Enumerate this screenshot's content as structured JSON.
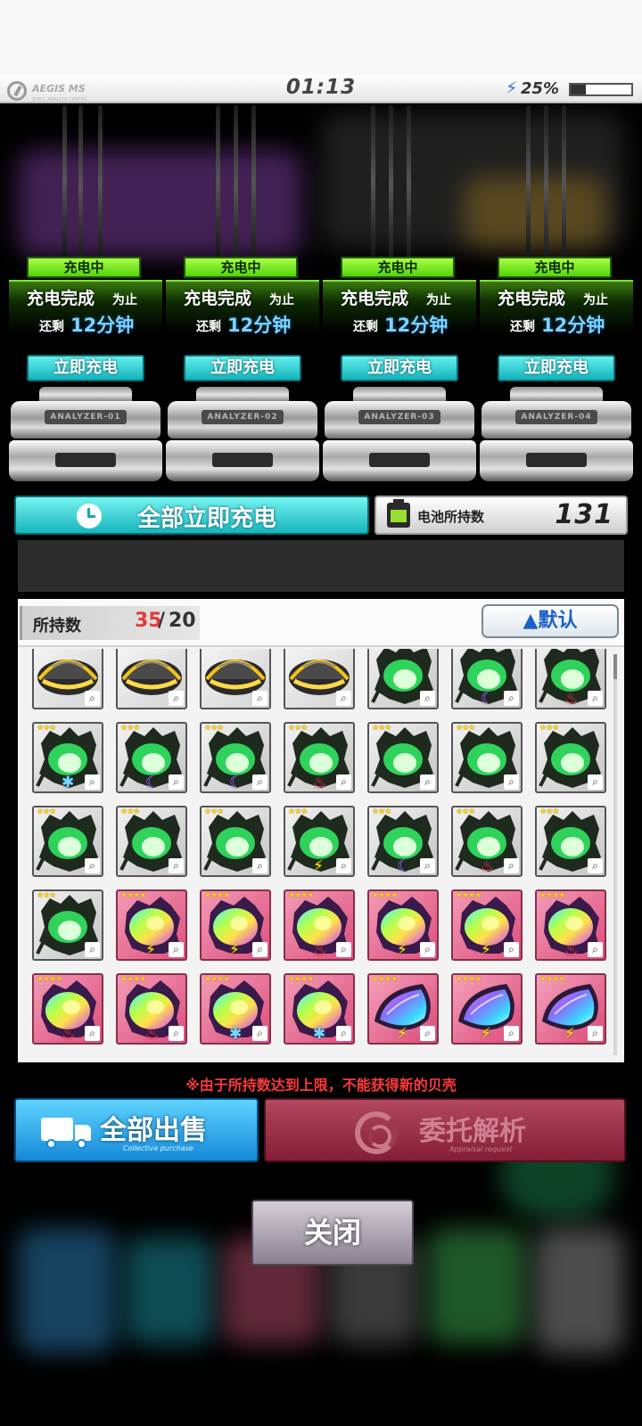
{
  "status_bar": {
    "logo_text": "AEGIS MS",
    "logo_sub": "SHELL ANALYZE CENTER",
    "clock": "01:13",
    "battery_percent_label": "25%",
    "battery_level": 0.25
  },
  "analyzers": [
    {
      "badge": "充电中",
      "status_main": "充电完成",
      "status_suffix": "为止",
      "remaining_prefix": "还剩",
      "remaining_time": "12分钟",
      "button": "立即充电",
      "plate": "ANALYZER-01"
    },
    {
      "badge": "充电中",
      "status_main": "充电完成",
      "status_suffix": "为止",
      "remaining_prefix": "还剩",
      "remaining_time": "12分钟",
      "button": "立即充电",
      "plate": "ANALYZER-02"
    },
    {
      "badge": "充电中",
      "status_main": "充电完成",
      "status_suffix": "为止",
      "remaining_prefix": "还剩",
      "remaining_time": "12分钟",
      "button": "立即充电",
      "plate": "ANALYZER-03"
    },
    {
      "badge": "充电中",
      "status_main": "充电完成",
      "status_suffix": "为止",
      "remaining_prefix": "还剩",
      "remaining_time": "12分钟",
      "button": "立即充电",
      "plate": "ANALYZER-04"
    }
  ],
  "charge_all": {
    "label": "全部立即充电",
    "icon": "clock-icon"
  },
  "battery_stock": {
    "label": "电池所持数",
    "value": "131",
    "icon": "battery-pack-icon"
  },
  "inventory": {
    "count_label": "所持数",
    "count_current": "35",
    "count_separator": "/",
    "count_max": "20",
    "sort_label": "▲默认",
    "items": [
      {
        "type": "gold",
        "stars": "★",
        "attr": ""
      },
      {
        "type": "gold",
        "stars": "★",
        "attr": ""
      },
      {
        "type": "gold",
        "stars": "★",
        "attr": ""
      },
      {
        "type": "gold",
        "stars": "★",
        "attr": ""
      },
      {
        "type": "green",
        "stars": "★★★",
        "attr": ""
      },
      {
        "type": "green",
        "stars": "★★★",
        "attr": "moon"
      },
      {
        "type": "green",
        "stars": "★★★",
        "attr": "fire"
      },
      {
        "type": "green",
        "stars": "★★★",
        "attr": "ice"
      },
      {
        "type": "green",
        "stars": "★★★",
        "attr": "moon"
      },
      {
        "type": "green",
        "stars": "★★★",
        "attr": "moon"
      },
      {
        "type": "green",
        "stars": "★★★",
        "attr": "fire"
      },
      {
        "type": "green",
        "stars": "★★★",
        "attr": ""
      },
      {
        "type": "green",
        "stars": "★★★",
        "attr": ""
      },
      {
        "type": "green",
        "stars": "★★★",
        "attr": ""
      },
      {
        "type": "green",
        "stars": "★★★",
        "attr": ""
      },
      {
        "type": "green",
        "stars": "★★★",
        "attr": ""
      },
      {
        "type": "green",
        "stars": "★★★",
        "attr": ""
      },
      {
        "type": "green",
        "stars": "★★★",
        "attr": "bolt"
      },
      {
        "type": "green",
        "stars": "★★★",
        "attr": "moon"
      },
      {
        "type": "green",
        "stars": "★★★",
        "attr": "fire"
      },
      {
        "type": "green",
        "stars": "★★★",
        "attr": ""
      },
      {
        "type": "green",
        "stars": "★★★",
        "attr": ""
      },
      {
        "type": "rainbow",
        "stars": "★★★★",
        "attr": "bolt"
      },
      {
        "type": "rainbow",
        "stars": "★★★★",
        "attr": "bolt"
      },
      {
        "type": "rainbow",
        "stars": "★★★★",
        "attr": "fire"
      },
      {
        "type": "rainbow",
        "stars": "★★★★",
        "attr": "bolt"
      },
      {
        "type": "rainbow",
        "stars": "★★★★",
        "attr": "bolt"
      },
      {
        "type": "rainbow",
        "stars": "★★★★",
        "attr": "fire"
      },
      {
        "type": "rainbow",
        "stars": "★★★★",
        "attr": "fire"
      },
      {
        "type": "rainbow",
        "stars": "★★★★",
        "attr": "fire"
      },
      {
        "type": "rainbow",
        "stars": "★★★★",
        "attr": "ice"
      },
      {
        "type": "rainbow",
        "stars": "★★★★",
        "attr": "ice"
      },
      {
        "type": "crystal",
        "stars": "★★★★",
        "attr": "bolt"
      },
      {
        "type": "crystal",
        "stars": "★★★★",
        "attr": "bolt"
      },
      {
        "type": "crystal",
        "stars": "★★★★",
        "attr": "bolt"
      }
    ]
  },
  "notice": "※由于所持数达到上限，不能获得新的贝壳",
  "actions": {
    "sell_all": {
      "label": "全部出售",
      "sub": "Collective purchase"
    },
    "analyze": {
      "label": "委托解析",
      "sub": "Appraisal request"
    }
  },
  "close_label": "关闭",
  "colors": {
    "charging_green": "#52d40c",
    "teal_button": "#17b5be",
    "sell_blue": "#1589d8",
    "analyze_crimson": "#841e36",
    "warning_red": "#ff3a3a",
    "count_over_red": "#e43939"
  },
  "attr_icons": {
    "ice": "✱",
    "moon": "☾",
    "fire": "♨",
    "bolt": "⚡"
  }
}
